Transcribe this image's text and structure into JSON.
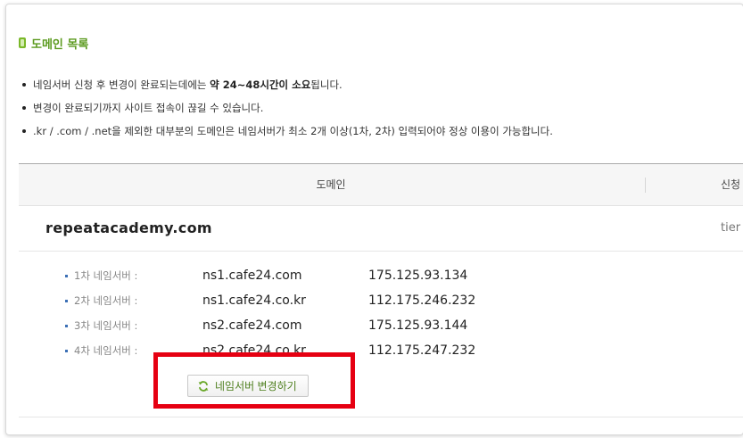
{
  "section": {
    "title": "도메인 목록"
  },
  "notes": [
    {
      "pre": "네임서버 신청 후 변경이 완료되는데에는 ",
      "bold": "약 24~48시간이 소요",
      "post": "됩니다."
    },
    {
      "pre": "변경이 완료되기까지 사이트 접속이 끊길 수 있습니다.",
      "bold": "",
      "post": ""
    },
    {
      "pre": ".kr / .com / .net을 제외한 대부분의 도메인은 네임서버가 최소 2개 이상(1차, 2차) 입력되어야 정상 이용이 가능합니다.",
      "bold": "",
      "post": ""
    }
  ],
  "table": {
    "header_domain": "도메인",
    "header_next": "신청"
  },
  "domain": {
    "name": "repeatacademy.com",
    "status": "tier"
  },
  "nameservers": [
    {
      "label": "1차 네임서버 :",
      "host": "ns1.cafe24.com",
      "ip": "175.125.93.134"
    },
    {
      "label": "2차 네임서버 :",
      "host": "ns1.cafe24.co.kr",
      "ip": "112.175.246.232"
    },
    {
      "label": "3차 네임서버 :",
      "host": "ns2.cafe24.com",
      "ip": "175.125.93.144"
    },
    {
      "label": "4차 네임서버 :",
      "host": "ns2.cafe24.co.kr",
      "ip": "112.175.247.232"
    }
  ],
  "buttons": {
    "change_ns": "네임서버 변경하기"
  },
  "icons": {
    "title": "bullet-square-icon",
    "change": "refresh-icon"
  },
  "colors": {
    "accent_green": "#5b9a1e",
    "highlight_red": "#e60012"
  }
}
